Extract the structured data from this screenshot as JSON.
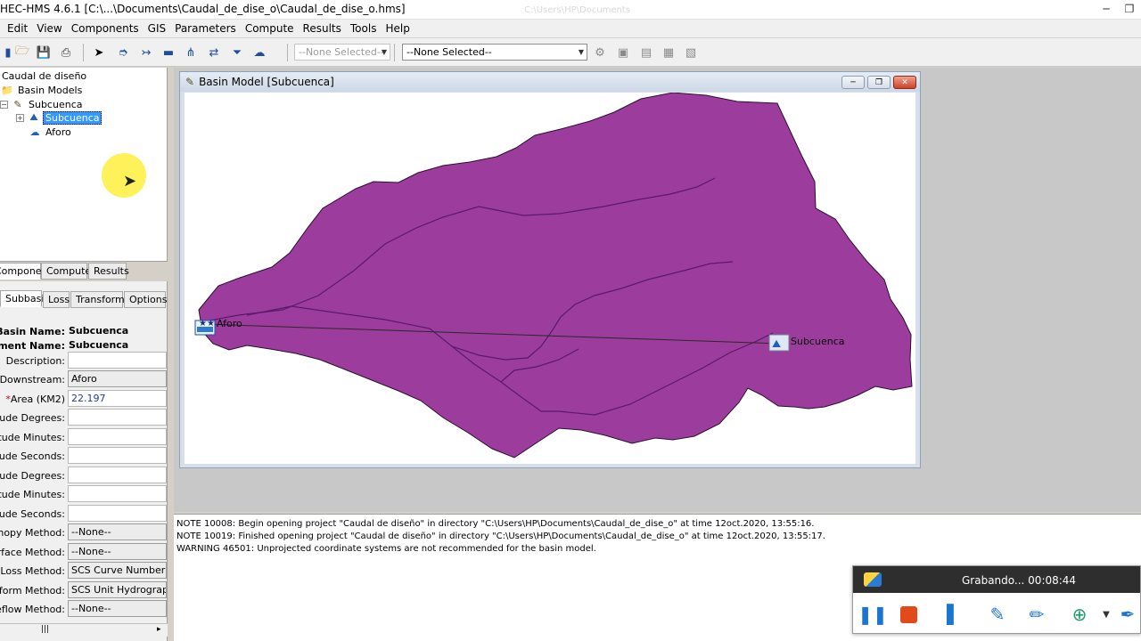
{
  "window": {
    "title": "HEC-HMS 4.6.1 [C:\\...\\Documents\\Caudal_de_dise_o\\Caudal_de_dise_o.hms]",
    "ghost_text": "C:\\Users\\HP\\Documents"
  },
  "menu": [
    "Edit",
    "View",
    "Components",
    "GIS",
    "Parameters",
    "Compute",
    "Results",
    "Tools",
    "Help"
  ],
  "toolbar": {
    "combo_small": "--None Selected--",
    "combo_large": "--None Selected--"
  },
  "tree": {
    "root": "Caudal de diseño",
    "basin_models": "Basin Models",
    "model": "Subcuenca",
    "subbasin": "Subcuenca",
    "sink": "Aforo"
  },
  "panel_tabs": [
    "Components",
    "Compute",
    "Results"
  ],
  "element_tabs": [
    "Subbasin",
    "Loss",
    "Transform",
    "Options"
  ],
  "properties": {
    "basin_name_label": "Basin Name:",
    "basin_name": "Subcuenca",
    "element_name_label": "Element Name:",
    "element_name": "Subcuenca",
    "description_label": "Description:",
    "description": "",
    "downstream_label": "Downstream:",
    "downstream": "Aforo",
    "area_label": "Area (KM2)",
    "area": "22.197",
    "lat_deg_label": "Latitude Degrees:",
    "lat_min_label": "Latitude Minutes:",
    "lat_sec_label": "Latitude Seconds:",
    "lon_deg_label": "Longitude Degrees:",
    "lon_min_label": "Longitude Minutes:",
    "lon_sec_label": "Longitude Seconds:",
    "canopy_label": "Canopy Method:",
    "canopy": "--None--",
    "surface_label": "Surface Method:",
    "surface": "--None--",
    "loss_label": "Loss Method:",
    "loss": "SCS Curve Number",
    "transform_label": "Transform Method:",
    "transform": "SCS Unit Hydrograph",
    "baseflow_label": "Baseflow Method:",
    "baseflow": "--None--"
  },
  "basin_window": {
    "title": "Basin Model [Subcuenca]",
    "sink_label": "Aforo",
    "subbasin_label": "Subcuenca",
    "basin_color": "#9c3c9c",
    "stream_color": "#5a1a6a"
  },
  "messages": [
    "NOTE 10008:  Begin opening project \"Caudal de diseño\" in directory \"C:\\Users\\HP\\Documents\\Caudal_de_dise_o\" at time 12oct.2020, 13:55:16.",
    "NOTE 10019:  Finished opening project \"Caudal de diseño\" in directory \"C:\\Users\\HP\\Documents\\Caudal_de_dise_o\" at time 12oct.2020, 13:55:17.",
    "WARNING 46501:  Unprojected coordinate systems are not recommended for the basin model."
  ],
  "recorder": {
    "status": "Grabando... 00:08:44"
  }
}
